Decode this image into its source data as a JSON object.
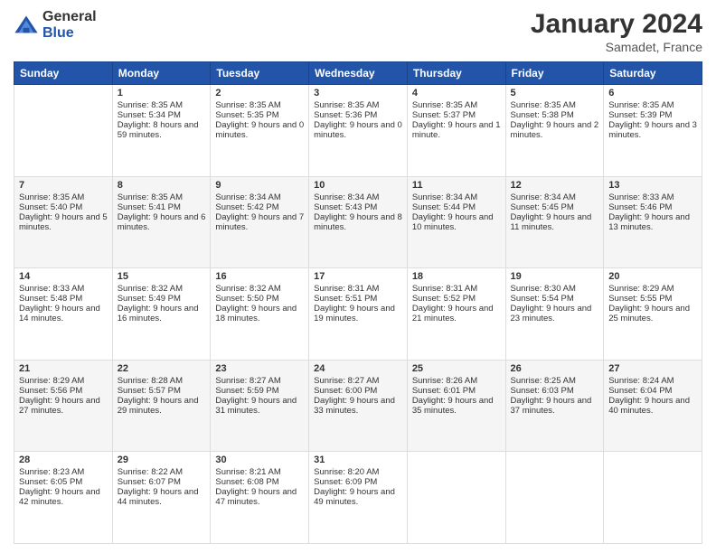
{
  "logo": {
    "general": "General",
    "blue": "Blue"
  },
  "header": {
    "month_year": "January 2024",
    "location": "Samadet, France"
  },
  "days_of_week": [
    "Sunday",
    "Monday",
    "Tuesday",
    "Wednesday",
    "Thursday",
    "Friday",
    "Saturday"
  ],
  "weeks": [
    [
      {
        "day": "",
        "sunrise": "",
        "sunset": "",
        "daylight": ""
      },
      {
        "day": "1",
        "sunrise": "Sunrise: 8:35 AM",
        "sunset": "Sunset: 5:34 PM",
        "daylight": "Daylight: 8 hours and 59 minutes."
      },
      {
        "day": "2",
        "sunrise": "Sunrise: 8:35 AM",
        "sunset": "Sunset: 5:35 PM",
        "daylight": "Daylight: 9 hours and 0 minutes."
      },
      {
        "day": "3",
        "sunrise": "Sunrise: 8:35 AM",
        "sunset": "Sunset: 5:36 PM",
        "daylight": "Daylight: 9 hours and 0 minutes."
      },
      {
        "day": "4",
        "sunrise": "Sunrise: 8:35 AM",
        "sunset": "Sunset: 5:37 PM",
        "daylight": "Daylight: 9 hours and 1 minute."
      },
      {
        "day": "5",
        "sunrise": "Sunrise: 8:35 AM",
        "sunset": "Sunset: 5:38 PM",
        "daylight": "Daylight: 9 hours and 2 minutes."
      },
      {
        "day": "6",
        "sunrise": "Sunrise: 8:35 AM",
        "sunset": "Sunset: 5:39 PM",
        "daylight": "Daylight: 9 hours and 3 minutes."
      }
    ],
    [
      {
        "day": "7",
        "sunrise": "Sunrise: 8:35 AM",
        "sunset": "Sunset: 5:40 PM",
        "daylight": "Daylight: 9 hours and 5 minutes."
      },
      {
        "day": "8",
        "sunrise": "Sunrise: 8:35 AM",
        "sunset": "Sunset: 5:41 PM",
        "daylight": "Daylight: 9 hours and 6 minutes."
      },
      {
        "day": "9",
        "sunrise": "Sunrise: 8:34 AM",
        "sunset": "Sunset: 5:42 PM",
        "daylight": "Daylight: 9 hours and 7 minutes."
      },
      {
        "day": "10",
        "sunrise": "Sunrise: 8:34 AM",
        "sunset": "Sunset: 5:43 PM",
        "daylight": "Daylight: 9 hours and 8 minutes."
      },
      {
        "day": "11",
        "sunrise": "Sunrise: 8:34 AM",
        "sunset": "Sunset: 5:44 PM",
        "daylight": "Daylight: 9 hours and 10 minutes."
      },
      {
        "day": "12",
        "sunrise": "Sunrise: 8:34 AM",
        "sunset": "Sunset: 5:45 PM",
        "daylight": "Daylight: 9 hours and 11 minutes."
      },
      {
        "day": "13",
        "sunrise": "Sunrise: 8:33 AM",
        "sunset": "Sunset: 5:46 PM",
        "daylight": "Daylight: 9 hours and 13 minutes."
      }
    ],
    [
      {
        "day": "14",
        "sunrise": "Sunrise: 8:33 AM",
        "sunset": "Sunset: 5:48 PM",
        "daylight": "Daylight: 9 hours and 14 minutes."
      },
      {
        "day": "15",
        "sunrise": "Sunrise: 8:32 AM",
        "sunset": "Sunset: 5:49 PM",
        "daylight": "Daylight: 9 hours and 16 minutes."
      },
      {
        "day": "16",
        "sunrise": "Sunrise: 8:32 AM",
        "sunset": "Sunset: 5:50 PM",
        "daylight": "Daylight: 9 hours and 18 minutes."
      },
      {
        "day": "17",
        "sunrise": "Sunrise: 8:31 AM",
        "sunset": "Sunset: 5:51 PM",
        "daylight": "Daylight: 9 hours and 19 minutes."
      },
      {
        "day": "18",
        "sunrise": "Sunrise: 8:31 AM",
        "sunset": "Sunset: 5:52 PM",
        "daylight": "Daylight: 9 hours and 21 minutes."
      },
      {
        "day": "19",
        "sunrise": "Sunrise: 8:30 AM",
        "sunset": "Sunset: 5:54 PM",
        "daylight": "Daylight: 9 hours and 23 minutes."
      },
      {
        "day": "20",
        "sunrise": "Sunrise: 8:29 AM",
        "sunset": "Sunset: 5:55 PM",
        "daylight": "Daylight: 9 hours and 25 minutes."
      }
    ],
    [
      {
        "day": "21",
        "sunrise": "Sunrise: 8:29 AM",
        "sunset": "Sunset: 5:56 PM",
        "daylight": "Daylight: 9 hours and 27 minutes."
      },
      {
        "day": "22",
        "sunrise": "Sunrise: 8:28 AM",
        "sunset": "Sunset: 5:57 PM",
        "daylight": "Daylight: 9 hours and 29 minutes."
      },
      {
        "day": "23",
        "sunrise": "Sunrise: 8:27 AM",
        "sunset": "Sunset: 5:59 PM",
        "daylight": "Daylight: 9 hours and 31 minutes."
      },
      {
        "day": "24",
        "sunrise": "Sunrise: 8:27 AM",
        "sunset": "Sunset: 6:00 PM",
        "daylight": "Daylight: 9 hours and 33 minutes."
      },
      {
        "day": "25",
        "sunrise": "Sunrise: 8:26 AM",
        "sunset": "Sunset: 6:01 PM",
        "daylight": "Daylight: 9 hours and 35 minutes."
      },
      {
        "day": "26",
        "sunrise": "Sunrise: 8:25 AM",
        "sunset": "Sunset: 6:03 PM",
        "daylight": "Daylight: 9 hours and 37 minutes."
      },
      {
        "day": "27",
        "sunrise": "Sunrise: 8:24 AM",
        "sunset": "Sunset: 6:04 PM",
        "daylight": "Daylight: 9 hours and 40 minutes."
      }
    ],
    [
      {
        "day": "28",
        "sunrise": "Sunrise: 8:23 AM",
        "sunset": "Sunset: 6:05 PM",
        "daylight": "Daylight: 9 hours and 42 minutes."
      },
      {
        "day": "29",
        "sunrise": "Sunrise: 8:22 AM",
        "sunset": "Sunset: 6:07 PM",
        "daylight": "Daylight: 9 hours and 44 minutes."
      },
      {
        "day": "30",
        "sunrise": "Sunrise: 8:21 AM",
        "sunset": "Sunset: 6:08 PM",
        "daylight": "Daylight: 9 hours and 47 minutes."
      },
      {
        "day": "31",
        "sunrise": "Sunrise: 8:20 AM",
        "sunset": "Sunset: 6:09 PM",
        "daylight": "Daylight: 9 hours and 49 minutes."
      },
      {
        "day": "",
        "sunrise": "",
        "sunset": "",
        "daylight": ""
      },
      {
        "day": "",
        "sunrise": "",
        "sunset": "",
        "daylight": ""
      },
      {
        "day": "",
        "sunrise": "",
        "sunset": "",
        "daylight": ""
      }
    ]
  ]
}
